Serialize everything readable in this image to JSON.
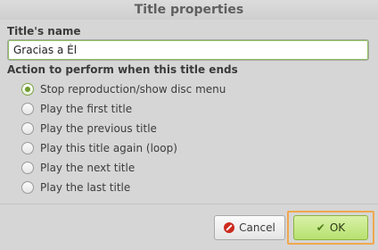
{
  "window": {
    "title": "Title properties"
  },
  "name_section": {
    "label": "Title's name",
    "value": "Gracias a Él"
  },
  "action_section": {
    "label": "Action to perform when this title ends",
    "options": [
      {
        "label": "Stop reproduction/show disc menu",
        "checked": true
      },
      {
        "label": "Play the first title",
        "checked": false
      },
      {
        "label": "Play the previous title",
        "checked": false
      },
      {
        "label": "Play this title again (loop)",
        "checked": false
      },
      {
        "label": "Play the next title",
        "checked": false
      },
      {
        "label": "Play the last title",
        "checked": false
      }
    ]
  },
  "buttons": {
    "cancel_label": "Cancel",
    "cancel_icon": "cancel-icon",
    "ok_label": "OK",
    "ok_icon": "check-icon"
  },
  "colors": {
    "accent": "#b7e06f",
    "focus_ring": "#f0a84e",
    "radio_checked": "#6f9c2f",
    "cancel_icon": "#cc2a1e"
  }
}
